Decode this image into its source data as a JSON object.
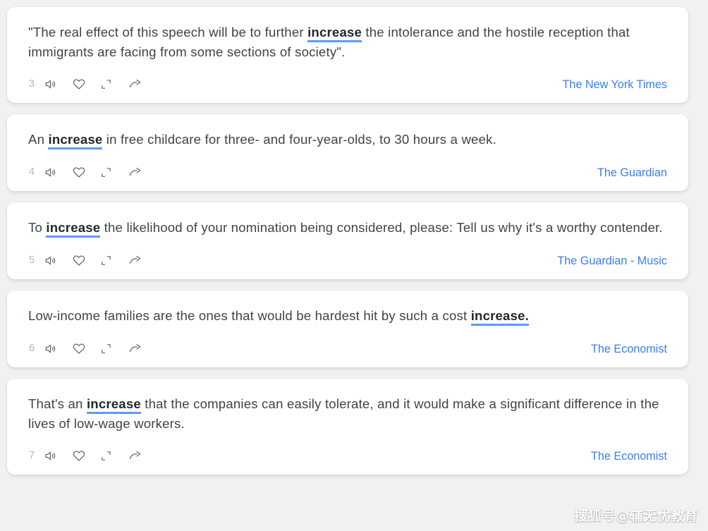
{
  "accent": {
    "link_blue": "#3b7df6",
    "underline_blue": "#5b9bf8",
    "text_gray": "#3f4448",
    "index_gray": "#b8b8b8",
    "page_bg": "#f1f1f1",
    "card_bg": "#ffffff"
  },
  "keyword": "increase",
  "icons": {
    "speaker": "speaker-icon",
    "heart": "heart-icon",
    "expand": "expand-icon",
    "share": "share-icon"
  },
  "cards": [
    {
      "index": "3",
      "pre": "\"The real effect of this speech will be to further ",
      "keyword": "increase",
      "post": " the intolerance and the hostile reception that immigrants are facing from some sections of society\".",
      "source": "The New York Times"
    },
    {
      "index": "4",
      "pre": "An ",
      "keyword": "increase",
      "post": " in free childcare for three- and four-year-olds, to 30 hours a week.",
      "source": "The Guardian"
    },
    {
      "index": "5",
      "pre": "To ",
      "keyword": "increase",
      "post": " the likelihood of your nomination being considered, please: Tell us why it's a worthy contender.",
      "source": "The Guardian - Music"
    },
    {
      "index": "6",
      "pre": "Low-income families are the ones that would be hardest hit by such a cost ",
      "keyword": "increase.",
      "post": "",
      "source": "The Economist"
    },
    {
      "index": "7",
      "pre": "That's an ",
      "keyword": "increase",
      "post": " that the companies can easily tolerate, and it would make a significant difference in the lives of low-wage workers.",
      "source": "The Economist"
    }
  ],
  "watermark": "搜狐号@辅无忧教育"
}
